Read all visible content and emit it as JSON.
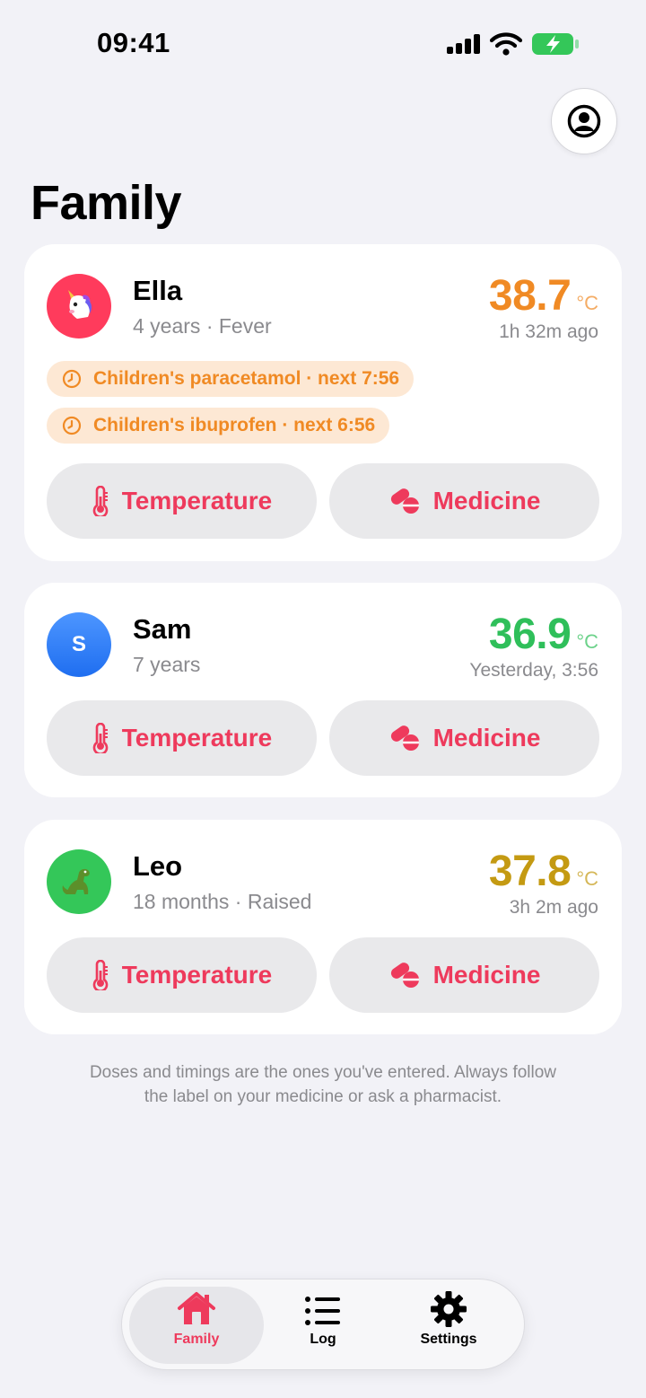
{
  "status": {
    "time": "09:41"
  },
  "page": {
    "title": "Family"
  },
  "children": [
    {
      "name": "Ella",
      "subtitle": "4 years · Fever",
      "avatar": "unicorn",
      "avatar_color": "#ff3b5c",
      "temperature": "38.7",
      "unit": "°C",
      "temp_color": "#f08a24",
      "last_reading": "1h 32m ago",
      "reminders": [
        "Children's paracetamol · next 7:56",
        "Children's ibuprofen · next 6:56"
      ]
    },
    {
      "name": "Sam",
      "subtitle": "7 years",
      "avatar": "S",
      "avatar_color": "#2f7cf6",
      "temperature": "36.9",
      "unit": "°C",
      "temp_color": "#2fbf5a",
      "last_reading": "Yesterday, 3:56",
      "reminders": []
    },
    {
      "name": "Leo",
      "subtitle": "18 months · Raised",
      "avatar": "dinosaur",
      "avatar_color": "#34c759",
      "temperature": "37.8",
      "unit": "°C",
      "temp_color": "#c49a12",
      "last_reading": "3h 2m ago",
      "reminders": []
    }
  ],
  "actions": {
    "temperature_label": "Temperature",
    "medicine_label": "Medicine"
  },
  "disclaimer": {
    "line1": "Doses and timings are the ones you've entered. Always follow",
    "line2": "the label on your medicine or ask a pharmacist."
  },
  "tabs": [
    {
      "label": "Family",
      "icon": "house-icon",
      "active": true
    },
    {
      "label": "Log",
      "icon": "list-icon",
      "active": false
    },
    {
      "label": "Settings",
      "icon": "gear-icon",
      "active": false
    }
  ],
  "colors": {
    "accent": "#ee3a5c",
    "background": "#f2f2f7"
  }
}
